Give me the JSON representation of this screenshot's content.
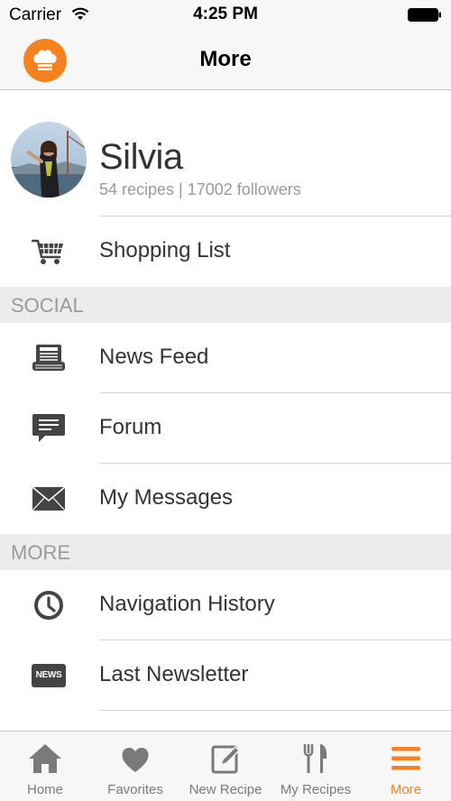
{
  "status_bar": {
    "carrier": "Carrier",
    "time": "4:25 PM"
  },
  "nav": {
    "title": "More",
    "logo_icon": "chef-hat-icon"
  },
  "profile": {
    "name": "Silvia",
    "stats": "54 recipes | 17002 followers"
  },
  "menu": {
    "shopping_list": {
      "label": "Shopping List",
      "icon": "shopping-cart-icon"
    },
    "social_header": "SOCIAL",
    "news_feed": {
      "label": "News Feed",
      "icon": "news-feed-icon"
    },
    "forum": {
      "label": "Forum",
      "icon": "chat-bubble-icon"
    },
    "my_messages": {
      "label": "My Messages",
      "icon": "envelope-icon"
    },
    "more_header": "MORE",
    "navigation_history": {
      "label": "Navigation History",
      "icon": "clock-icon"
    },
    "last_newsletter": {
      "label": "Last Newsletter",
      "icon": "newsletter-icon",
      "badge": "NEWS"
    }
  },
  "tabs": [
    {
      "label": "Home",
      "icon": "home-icon",
      "active": false
    },
    {
      "label": "Favorites",
      "icon": "heart-icon",
      "active": false
    },
    {
      "label": "New Recipe",
      "icon": "edit-icon",
      "active": false
    },
    {
      "label": "My Recipes",
      "icon": "fork-knife-icon",
      "active": false
    },
    {
      "label": "More",
      "icon": "menu-icon",
      "active": true
    }
  ],
  "colors": {
    "accent": "#f58220",
    "icon_gray": "#444444",
    "tab_inactive": "#7a7a7a"
  }
}
